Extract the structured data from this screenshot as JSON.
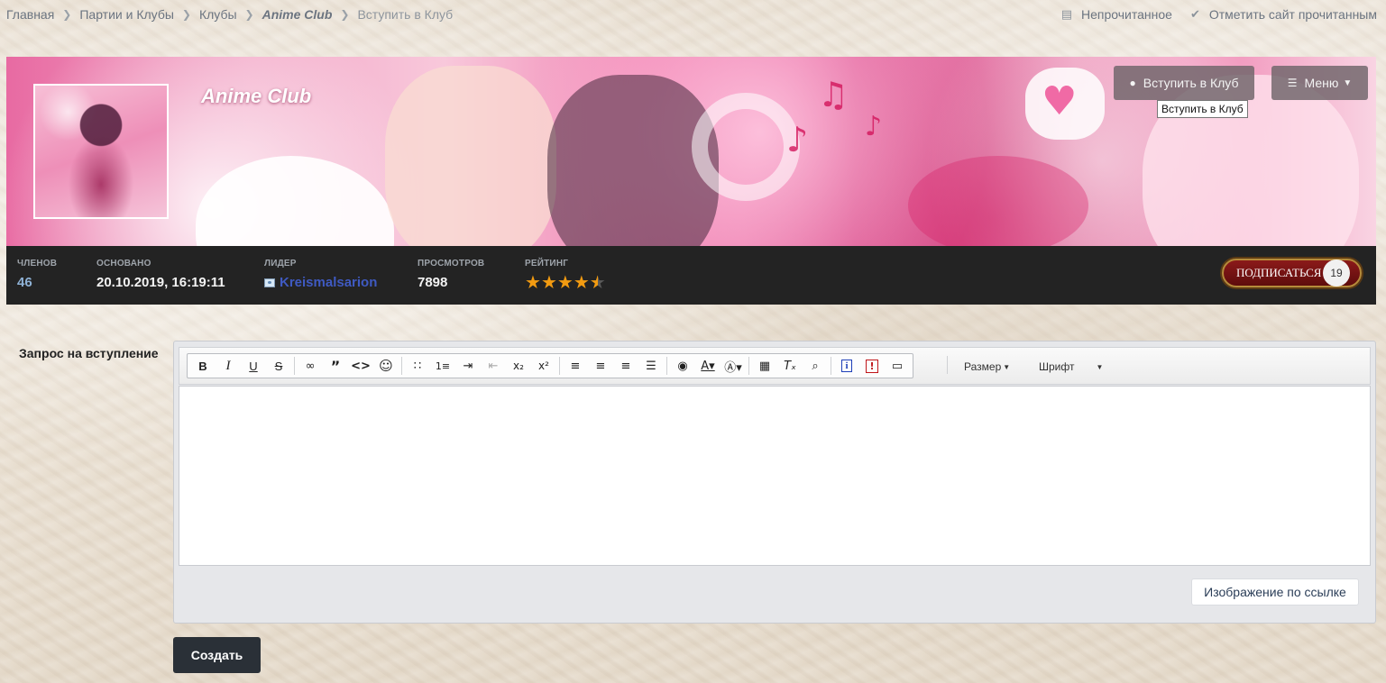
{
  "breadcrumb": [
    {
      "label": "Главная"
    },
    {
      "label": "Партии и Клубы"
    },
    {
      "label": "Клубы"
    },
    {
      "label": "Anime Club"
    },
    {
      "label": "Вступить в Клуб"
    }
  ],
  "top_links": {
    "unread": {
      "label": "Непрочитанное",
      "icon": "newspaper-icon"
    },
    "mark_read": {
      "label": "Отметить сайт прочитанным",
      "icon": "check-icon"
    }
  },
  "club": {
    "title": "Anime Club",
    "join_button": "Вступить в Клуб",
    "join_tooltip": "Вступить в Клуб",
    "menu_button": "Меню"
  },
  "stats": {
    "members": {
      "label": "Членов",
      "value": "46"
    },
    "founded": {
      "label": "Основано",
      "value": "20.10.2019, 16:19:11"
    },
    "leader": {
      "label": "Лидер",
      "value": "Kreismalsarion"
    },
    "views": {
      "label": "Просмотров",
      "value": "7898"
    },
    "rating": {
      "label": "Рейтинг",
      "value": 4.5,
      "max": 5
    }
  },
  "subscribe": {
    "label": "ПОДПИСАТЬСЯ",
    "count": "19"
  },
  "form": {
    "label": "Запрос на вступление",
    "editor_value": "",
    "toolbar": {
      "size_label": "Размер",
      "font_label": "Шрифт"
    },
    "image_link_button": "Изображение по ссылке",
    "submit_button": "Создать"
  },
  "colors": {
    "stats_bar": "#232323",
    "star": "#f29b11",
    "leader_link": "#3f5ac2",
    "members_value": "#8fb2d6",
    "submit_button": "#2a3037"
  }
}
